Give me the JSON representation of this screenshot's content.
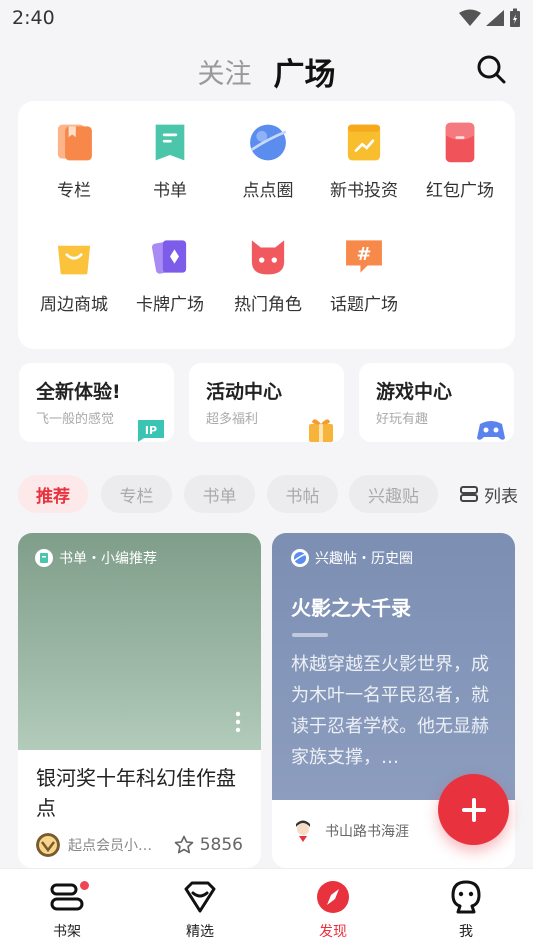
{
  "status": {
    "time": "2:40"
  },
  "top_tabs": [
    {
      "label": "关注"
    },
    {
      "label": "广场"
    }
  ],
  "grid": [
    {
      "label": "专栏",
      "icon": "column-icon"
    },
    {
      "label": "书单",
      "icon": "booklist-icon"
    },
    {
      "label": "点点圈",
      "icon": "planet-icon"
    },
    {
      "label": "新书投资",
      "icon": "invest-icon"
    },
    {
      "label": "红包广场",
      "icon": "redpacket-icon"
    },
    {
      "label": "周边商城",
      "icon": "shop-bag-icon"
    },
    {
      "label": "卡牌广场",
      "icon": "cards-icon"
    },
    {
      "label": "热门角色",
      "icon": "character-icon"
    },
    {
      "label": "话题广场",
      "icon": "topic-icon"
    }
  ],
  "entries": [
    {
      "title": "全新体验!",
      "subtitle": "飞一般的感觉"
    },
    {
      "title": "活动中心",
      "subtitle": "超多福利"
    },
    {
      "title": "游戏中心",
      "subtitle": "好玩有趣"
    }
  ],
  "filters": [
    "推荐",
    "专栏",
    "书单",
    "书帖",
    "兴趣贴"
  ],
  "list_toggle": "列表",
  "cards": {
    "left": {
      "tag": "书单・小编推荐",
      "title": "银河奖十年科幻佳作盘点",
      "author": "起点会员小秘书",
      "likes": "5856"
    },
    "right": {
      "tag": "兴趣帖・历史圈",
      "title": "火影之大千录",
      "text": "林越穿越至火影世界，成为木叶一名平民忍者，就读于忍者学校。他无显赫家族支撑，…",
      "author": "书山路书海涯"
    }
  },
  "nav": [
    {
      "label": "书架"
    },
    {
      "label": "精选"
    },
    {
      "label": "发现"
    },
    {
      "label": "我"
    }
  ],
  "colors": {
    "accent": "#e8323e"
  }
}
